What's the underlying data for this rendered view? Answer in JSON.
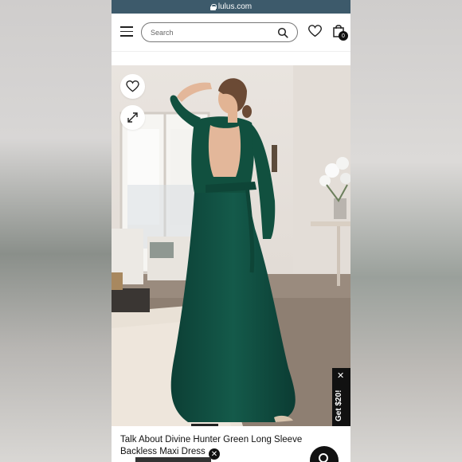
{
  "browser": {
    "url": "lulus.com"
  },
  "header": {
    "search": {
      "placeholder": "Search",
      "value": ""
    },
    "bag_count": "0"
  },
  "hero": {
    "image_description_icon_names": [
      "heart-icon",
      "expand-icon"
    ]
  },
  "promo": {
    "label": "Get $20!",
    "close_label": "✕"
  },
  "product": {
    "title": "Talk About Divine Hunter Green Long Sleeve Backless Maxi Dress",
    "close_label": "✕"
  },
  "colors": {
    "url_bar": "#3d5a6b",
    "dress": "#0f4a3e",
    "promo_bg": "#111111"
  }
}
